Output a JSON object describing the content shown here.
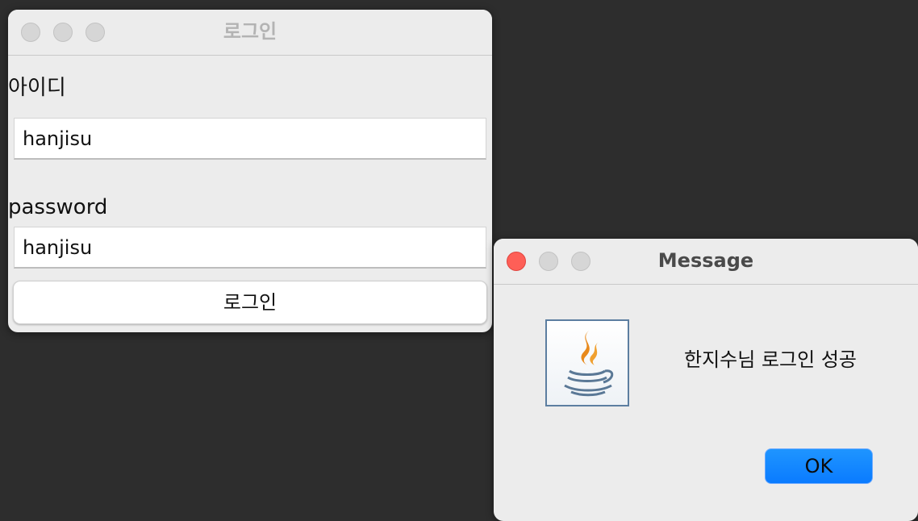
{
  "login_window": {
    "title": "로그인",
    "id_label": "아이디",
    "id_value": "hanjisu",
    "password_label": "password",
    "password_value": "hanjisu",
    "login_button_label": "로그인"
  },
  "message_window": {
    "title": "Message",
    "icon": "java-icon",
    "message": "한지수님 로그인 성공",
    "ok_button_label": "OK"
  },
  "colors": {
    "desktop_background": "#2d2d2d",
    "window_background": "#ececec",
    "close_button_red": "#fe5f57",
    "ok_button_blue": "#0a7bff"
  }
}
